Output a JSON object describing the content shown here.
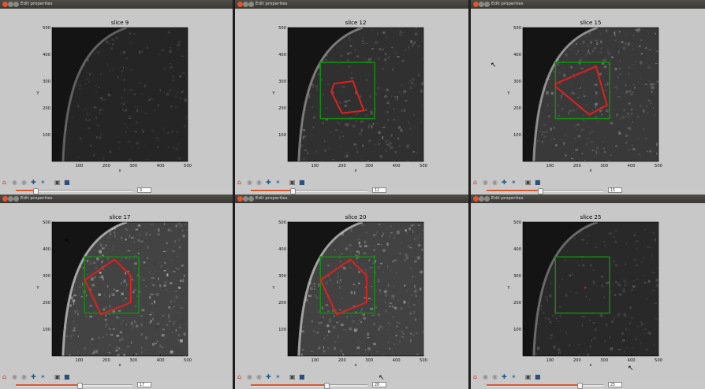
{
  "window_title": "Edit properties",
  "axis": {
    "x_label": "x",
    "y_label": "Y",
    "range": [
      0,
      500
    ],
    "x_ticks": [
      "100",
      "200",
      "300",
      "400",
      "500"
    ],
    "y_ticks": [
      "100",
      "200",
      "300",
      "400",
      "500"
    ]
  },
  "toolbar_icons": [
    "home-icon",
    "back-icon",
    "forward-icon",
    "pan-icon",
    "zoom-icon",
    "configure-icon",
    "save-icon"
  ],
  "colors": {
    "roi_box": "#138a13",
    "roi_polygon": "#e0201e",
    "slider_fill": "#d9542a",
    "figure_bg": "#c8c8c8",
    "image_bg": "#141414"
  },
  "panels": [
    {
      "title": "slice 9",
      "slice_value": "9",
      "slider_fraction": 0.17,
      "has_box": false,
      "has_polygon": false,
      "brightness": 0.12
    },
    {
      "title": "slice 12",
      "slice_value": "12",
      "slider_fraction": 0.36,
      "has_box": true,
      "has_polygon": true,
      "brightness": 0.3
    },
    {
      "title": "slice 15",
      "slice_value": "15",
      "slider_fraction": 0.46,
      "has_box": true,
      "has_polygon": true,
      "brightness": 0.45
    },
    {
      "title": "slice 17",
      "slice_value": "17",
      "slider_fraction": 0.55,
      "has_box": true,
      "has_polygon": true,
      "brightness": 0.62
    },
    {
      "title": "slice 20",
      "slice_value": "20",
      "slider_fraction": 0.65,
      "has_box": true,
      "has_polygon": true,
      "brightness": 0.6
    },
    {
      "title": "slice 25",
      "slice_value": "25",
      "slider_fraction": 0.8,
      "has_box": true,
      "has_polygon": false,
      "brightness": 0.18
    }
  ]
}
